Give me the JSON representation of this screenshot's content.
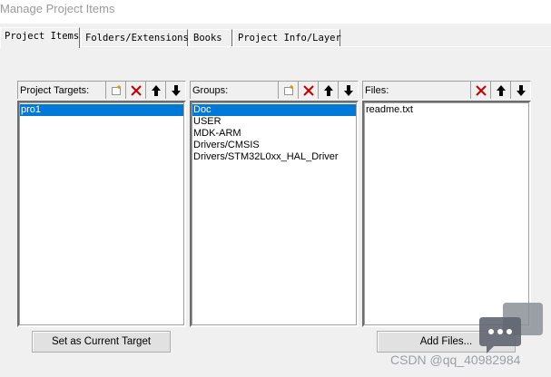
{
  "window": {
    "title": "Manage Project Items"
  },
  "tabs": [
    {
      "label": "Project Items",
      "active": true
    },
    {
      "label": "Folders/Extensions",
      "active": false
    },
    {
      "label": "Books",
      "active": false
    },
    {
      "label": "Project Info/Layer",
      "active": false
    }
  ],
  "targets": {
    "label": "Project Targets:",
    "items": [
      "pro1"
    ],
    "selected": 0
  },
  "groups": {
    "label": "Groups:",
    "items": [
      "Doc",
      "USER",
      "MDK-ARM",
      "Drivers/CMSIS",
      "Drivers/STM32L0xx_HAL_Driver"
    ],
    "selected": 0
  },
  "files": {
    "label": "Files:",
    "items": [
      "readme.txt"
    ]
  },
  "buttons": {
    "set_current": "Set as Current Target",
    "add_files": "Add Files..."
  },
  "watermark": {
    "text": "CSDN @qq_40982984"
  },
  "icons": {
    "new": "new-item-icon",
    "delete": "delete-icon",
    "up": "move-up-icon",
    "down": "move-down-icon"
  },
  "colors": {
    "selection": "#0078d7",
    "delete": "#c00000"
  }
}
